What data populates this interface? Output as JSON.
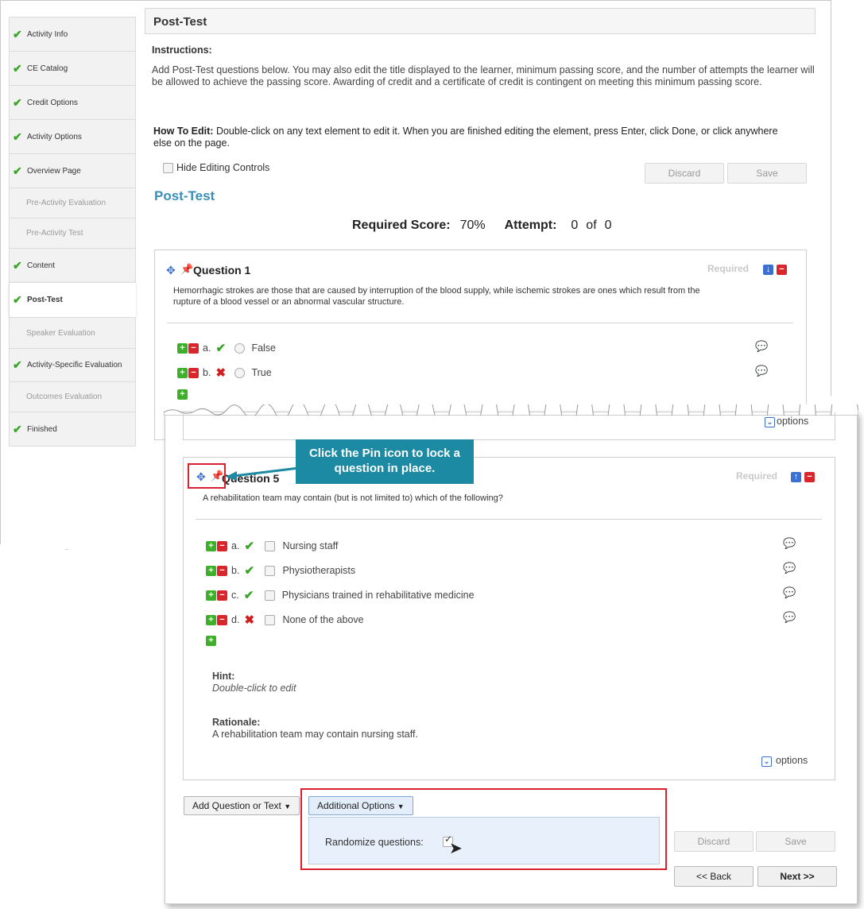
{
  "sidebar": {
    "items": [
      {
        "label": "Activity Info",
        "done": true
      },
      {
        "label": "CE Catalog",
        "done": true
      },
      {
        "label": "Credit Options",
        "done": true
      },
      {
        "label": "Activity Options",
        "done": true
      },
      {
        "label": "Overview Page",
        "done": true
      },
      {
        "label": "Pre-Activity Evaluation",
        "done": false
      },
      {
        "label": "Pre-Activity Test",
        "done": false
      },
      {
        "label": "Content",
        "done": true
      },
      {
        "label": "Post-Test",
        "done": true,
        "active": true
      },
      {
        "label": "Speaker Evaluation",
        "done": false
      },
      {
        "label": "Activity-Specific Evaluation",
        "done": true
      },
      {
        "label": "Outcomes Evaluation",
        "done": false
      },
      {
        "label": "Finished",
        "done": true
      }
    ]
  },
  "header": {
    "title": "Post-Test"
  },
  "instructions": {
    "heading": "Instructions:",
    "body": "Add Post-Test questions below. You may also edit the title displayed to the learner, minimum passing score, and the number of attempts the learner will be allowed to achieve the passing score. Awarding of credit and a certificate of credit is contingent on meeting this minimum passing score.",
    "how_label": "How To Edit:",
    "how_body": "Double-click on any text element to edit it. When you are finished editing the element, press Enter, click Done, or click anywhere else on the page."
  },
  "hide_controls_label": "Hide Editing Controls",
  "buttons": {
    "discard": "Discard",
    "save": "Save",
    "back": "<< Back",
    "next": "Next >>"
  },
  "section_title": "Post-Test",
  "score": {
    "required_label": "Required Score:",
    "required_value": "70%",
    "attempt_label": "Attempt:",
    "attempt_value": "0",
    "of_label": "of",
    "attempt_total": "0"
  },
  "question1": {
    "title": "Question 1",
    "required": "Required",
    "text": "Hemorrhagic strokes are those that are caused by interruption of the blood supply, while ischemic strokes are ones which result from the rupture of a blood vessel or an abnormal vascular structure.",
    "answers": [
      {
        "letter": "a.",
        "correct": true,
        "label": "False"
      },
      {
        "letter": "b.",
        "correct": false,
        "label": "True"
      }
    ]
  },
  "options_label": "options",
  "callout": "Click the Pin icon to lock a question in place.",
  "question5": {
    "title": "Question 5",
    "required": "Required",
    "text": "A rehabilitation team may contain (but is not limited to) which of the following?",
    "answers": [
      {
        "letter": "a.",
        "correct": true,
        "label": "Nursing staff"
      },
      {
        "letter": "b.",
        "correct": true,
        "label": "Physiotherapists"
      },
      {
        "letter": "c.",
        "correct": true,
        "label": "Physicians trained in rehabilitative medicine"
      },
      {
        "letter": "d.",
        "correct": false,
        "label": "None of the above"
      }
    ],
    "hint_label": "Hint:",
    "hint_value": "Double-click to edit",
    "rationale_label": "Rationale:",
    "rationale_value": "A rehabilitation team may contain nursing staff."
  },
  "toolbar": {
    "add_question": "Add Question or Text",
    "additional_options": "Additional Options"
  },
  "randomize_label": "Randomize questions:",
  "colors": {
    "accent": "#3a8fb7",
    "callout": "#1d8aa3",
    "highlight": "#d8202f",
    "check": "#3aa427"
  }
}
